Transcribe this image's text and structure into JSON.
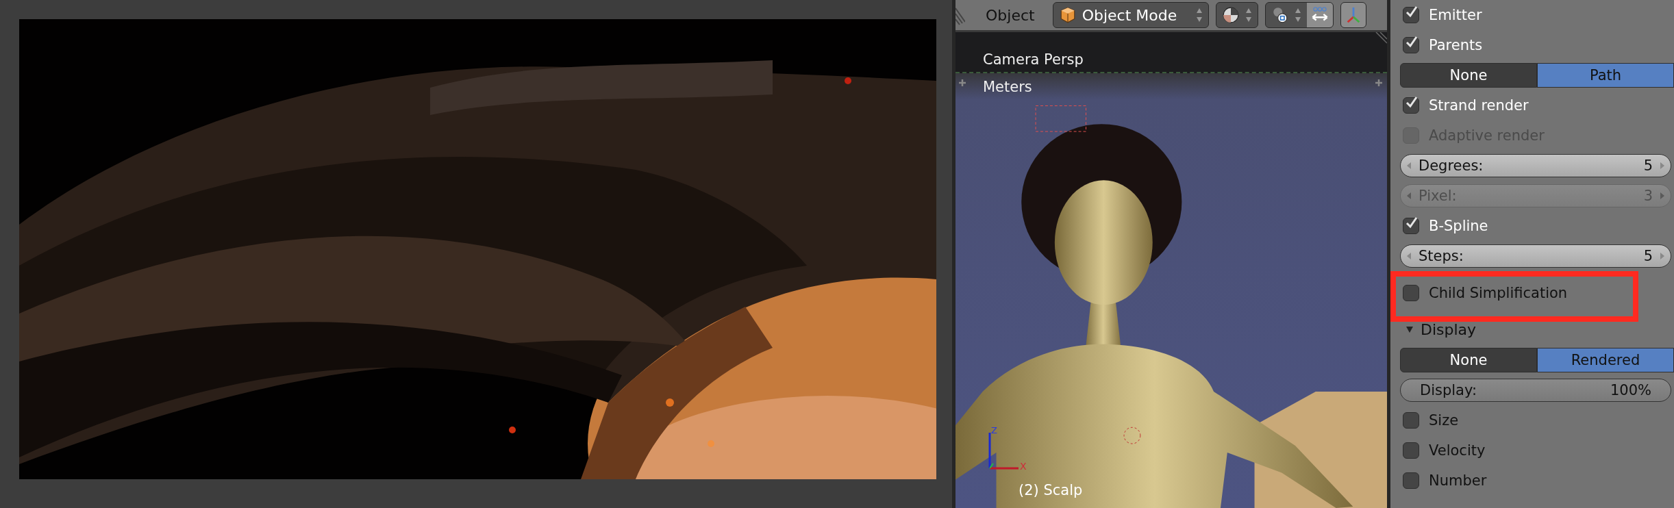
{
  "header": {
    "menu": "Object",
    "mode": "Object Mode"
  },
  "viewport": {
    "view_name": "Camera Persp",
    "units": "Meters",
    "object_label": "(2) Scalp",
    "axes": [
      "Z",
      "X"
    ]
  },
  "panel": {
    "items": [
      {
        "kind": "checkbox",
        "label": "Emitter",
        "checked": true,
        "disabled": false,
        "highlighted": false
      },
      {
        "kind": "checkbox",
        "label": "Parents",
        "checked": true,
        "disabled": false,
        "highlighted": false
      },
      {
        "kind": "toggle",
        "options": [
          {
            "label": "None",
            "selected": false
          },
          {
            "label": "Path",
            "selected": true
          }
        ]
      },
      {
        "kind": "checkbox",
        "label": "Strand render",
        "checked": true,
        "disabled": false,
        "highlighted": false
      },
      {
        "kind": "checkbox",
        "label": "Adaptive render",
        "checked": false,
        "disabled": true,
        "highlighted": false
      },
      {
        "kind": "number",
        "label": "Degrees:",
        "value": "5",
        "disabled": false,
        "arrows": true
      },
      {
        "kind": "number",
        "label": "Pixel:",
        "value": "3",
        "disabled": true,
        "arrows": true
      },
      {
        "kind": "checkbox",
        "label": "B-Spline",
        "checked": true,
        "disabled": false,
        "highlighted": false
      },
      {
        "kind": "number",
        "label": "Steps:",
        "value": "5",
        "disabled": false,
        "arrows": true
      },
      {
        "kind": "checkbox",
        "label": "Child Simplification",
        "checked": false,
        "disabled": false,
        "highlighted": true
      },
      {
        "kind": "section",
        "label": "Display",
        "expanded": true
      },
      {
        "kind": "toggle",
        "options": [
          {
            "label": "None",
            "selected": false
          },
          {
            "label": "Rendered",
            "selected": true
          }
        ]
      },
      {
        "kind": "number",
        "label": "Display:",
        "value": "100%",
        "disabled": false,
        "arrows": false
      },
      {
        "kind": "checkbox",
        "label": "Size",
        "checked": false,
        "disabled": false,
        "highlighted": false
      },
      {
        "kind": "checkbox",
        "label": "Velocity",
        "checked": false,
        "disabled": false,
        "highlighted": false
      },
      {
        "kind": "checkbox",
        "label": "Number",
        "checked": false,
        "disabled": false,
        "highlighted": false
      }
    ]
  }
}
